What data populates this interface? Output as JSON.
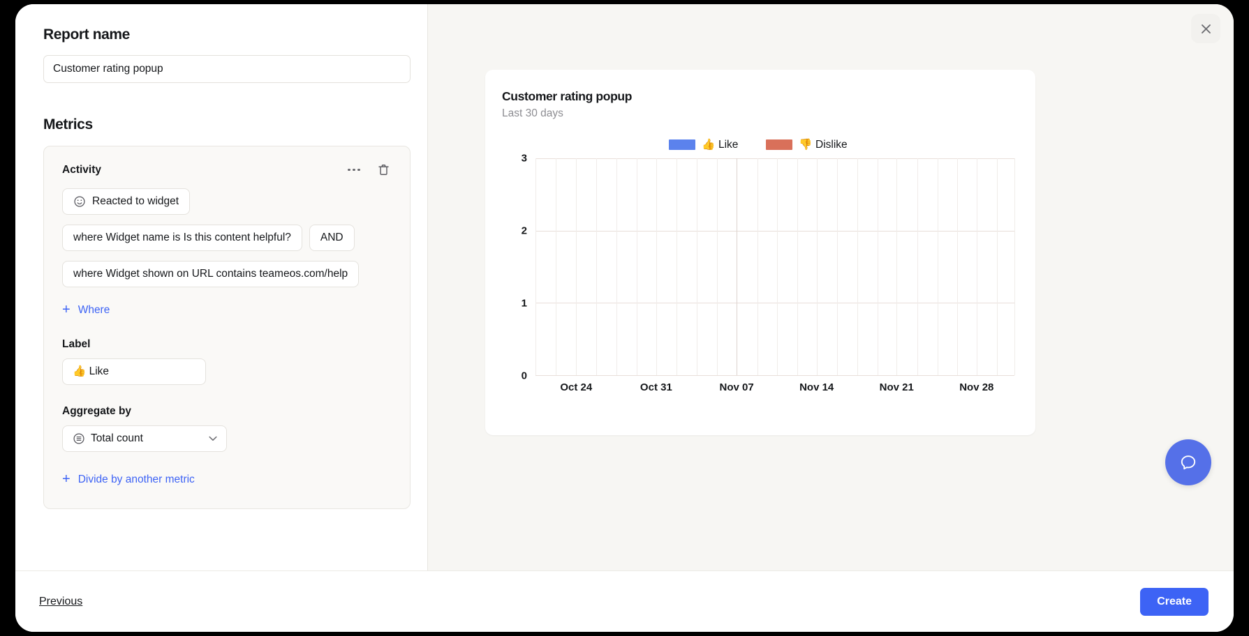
{
  "modal": {
    "close_icon": "close-icon"
  },
  "report": {
    "name_label": "Report name",
    "name_value": "Customer rating popup",
    "name_placeholder": "Report name"
  },
  "metrics": {
    "section_label": "Metrics",
    "card": {
      "title": "Activity",
      "more_icon": "ellipsis-icon",
      "delete_icon": "trash-icon",
      "event_chip": {
        "icon": "smiley-icon",
        "label": "Reacted to widget"
      },
      "filters": [
        {
          "text": "where Widget name is Is this content helpful?",
          "operator": "AND"
        },
        {
          "text": "where Widget shown on URL contains teameos.com/help",
          "operator": ""
        }
      ],
      "add_where_label": "Where",
      "label_field": {
        "label": "Label",
        "value": "👍 Like"
      },
      "aggregate_field": {
        "label": "Aggregate by",
        "value": "Total count",
        "icon": "sigma-icon",
        "chevron": "chevron-down-icon"
      },
      "divide_label": "Divide by another metric"
    }
  },
  "preview": {
    "title": "Customer rating popup",
    "subtitle": "Last 30 days"
  },
  "footer": {
    "previous_label": "Previous",
    "create_label": "Create"
  },
  "help": {
    "icon": "chat-bubble-icon"
  },
  "colors": {
    "accent": "#3d63f5",
    "like": "#5b82ed",
    "dislike": "#d9705a",
    "panel_bg": "#f7f6f3",
    "card_bg": "#faf9f7"
  },
  "chart_data": {
    "type": "bar",
    "title": "Customer rating popup",
    "subtitle": "Last 30 days",
    "xlabel": "",
    "ylabel": "",
    "ylim": [
      0,
      3
    ],
    "yticks": [
      0,
      1,
      2,
      3
    ],
    "grid": true,
    "legend_position": "top-center",
    "xtick_labels": [
      "Oct 24",
      "Oct 31",
      "Nov 07",
      "Nov 14",
      "Nov 21",
      "Nov 28"
    ],
    "xtick_positions_pct": [
      8.5,
      25.2,
      42.0,
      58.7,
      75.4,
      92.1
    ],
    "vertical_gridlines_pct": [
      0,
      4.2,
      8.5,
      12.7,
      16.9,
      21.1,
      25.2,
      29.5,
      33.7,
      37.9,
      42.0,
      46.3,
      50.4,
      54.6,
      58.7,
      63.0,
      67.2,
      71.4,
      75.4,
      79.7,
      83.9,
      88.1,
      92.1,
      96.4,
      100
    ],
    "major_gridline_pct": 42.0,
    "series": [
      {
        "name": "👍 Like",
        "color": "#5b82ed",
        "values": [
          0,
          0,
          0,
          0,
          0,
          0
        ]
      },
      {
        "name": "👎 Dislike",
        "color": "#d9705a",
        "values": [
          0,
          0,
          0,
          0,
          0,
          0
        ]
      }
    ],
    "note": "No bars rendered in the plot area; all series values are zero over the displayed range."
  }
}
